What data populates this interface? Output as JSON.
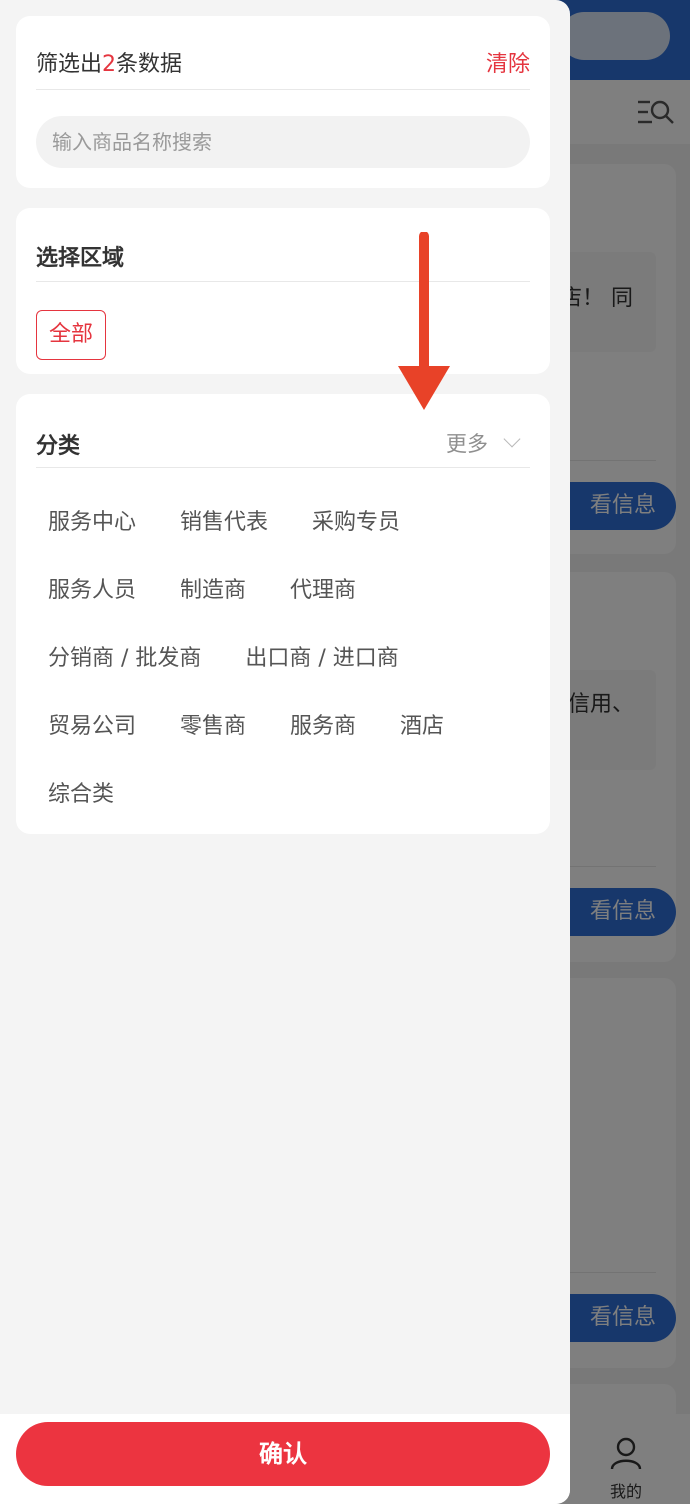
{
  "background": {
    "card1_text": "店！ 同",
    "card2_text": "信用、",
    "view_button_label": "看信息",
    "tab_me_label": "我的"
  },
  "drawer": {
    "result": {
      "prefix": "筛选出",
      "count": "2",
      "suffix": "条数据"
    },
    "clear_label": "清除",
    "search_placeholder": "输入商品名称搜索",
    "area": {
      "title": "选择区域",
      "tag_all": "全部"
    },
    "category": {
      "title": "分类",
      "more_label": "更多",
      "rows": [
        [
          "服务中心",
          "销售代表",
          "采购专员"
        ],
        [
          "服务人员",
          "制造商",
          "代理商"
        ],
        [
          "分销商 / 批发商",
          "出口商 / 进口商"
        ],
        [
          "贸易公司",
          "零售商",
          "服务商",
          "酒店"
        ],
        [
          "综合类"
        ]
      ]
    },
    "confirm_label": "确认"
  },
  "colors": {
    "accent": "#e5353f",
    "primary_blue": "#2f6fd6",
    "annotation_arrow": "#e84228"
  }
}
